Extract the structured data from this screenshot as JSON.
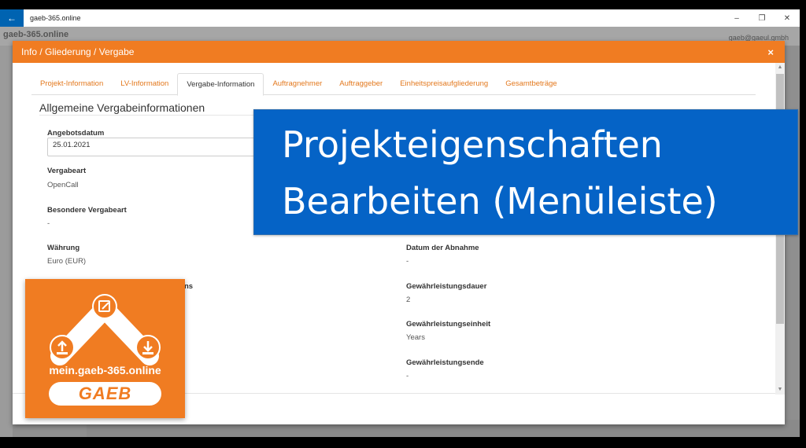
{
  "window": {
    "title": "gaeb-365.online",
    "back_glyph": "←",
    "minimize_glyph": "–",
    "restore_glyph": "❐",
    "close_glyph": "✕"
  },
  "background": {
    "app_name": "gaeb-365.online",
    "user": "gaeb@gaeul.gmbh"
  },
  "modal": {
    "title": "Info / Gliederung / Vergabe",
    "close_glyph": "×",
    "tabs": [
      {
        "label": "Projekt-Information",
        "active": false
      },
      {
        "label": "LV-Information",
        "active": false
      },
      {
        "label": "Vergabe-Information",
        "active": true
      },
      {
        "label": "Auftragnehmer",
        "active": false
      },
      {
        "label": "Auftraggeber",
        "active": false
      },
      {
        "label": "Einheitspreisaufgliederung",
        "active": false
      },
      {
        "label": "Gesamtbeträge",
        "active": false
      }
    ],
    "section_title": "Allgemeine Vergabeinformationen",
    "left_fields": {
      "angebotsdatum_label": "Angebotsdatum",
      "angebotsdatum_value": "25.01.2021",
      "vergabeart_label": "Vergabeart",
      "vergabeart_value": "OpenCall",
      "besondere_label": "Besondere Vergabeart",
      "besondere_value": "-",
      "waehrung_label": "Währung",
      "waehrung_value": "Euro (EUR)",
      "partial_label": "ns"
    },
    "right_fields": {
      "abnahme_label": "Datum der Abnahme",
      "abnahme_value": "-",
      "dauer_label": "Gewährleistungsdauer",
      "dauer_value": "2",
      "einheit_label": "Gewährleistungseinheit",
      "einheit_value": "Years",
      "ende_label": "Gewährleistungsende",
      "ende_value": "-"
    }
  },
  "banner": {
    "line1": "Projekteigenschaften",
    "line2": "Bearbeiten (Menüleiste)",
    "color": "#0563c6"
  },
  "logo_card": {
    "url": "mein.gaeb-365.online",
    "brand": "GAEB",
    "color": "#f07c22"
  },
  "accent_color": "#f07c22"
}
